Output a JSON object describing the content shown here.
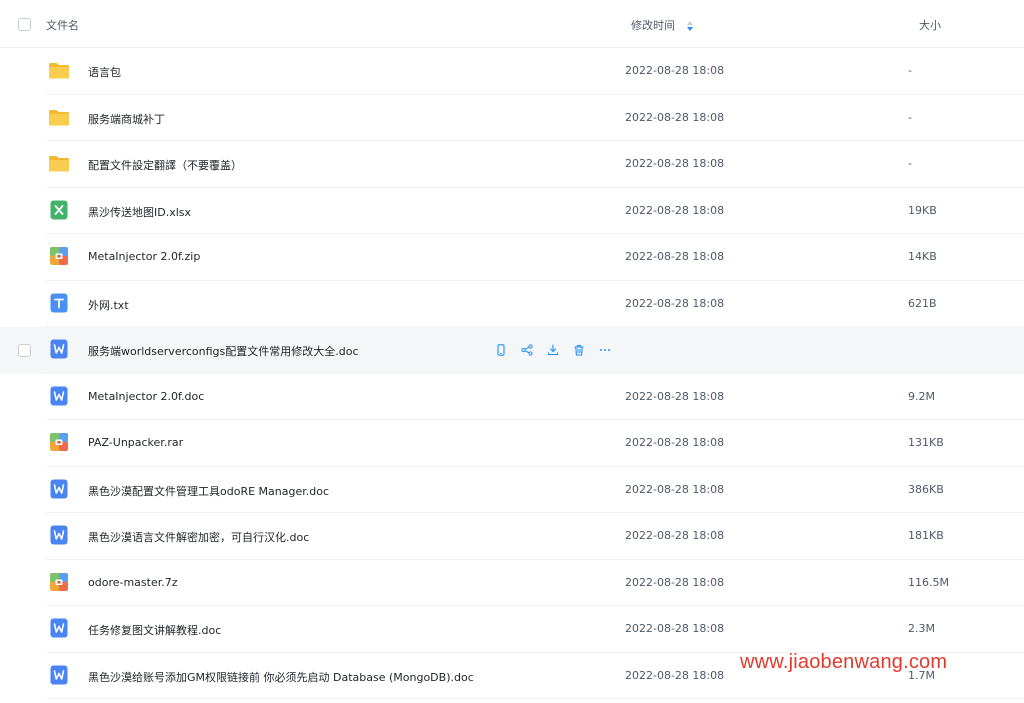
{
  "header": {
    "name_label": "文件名",
    "time_label": "修改时间",
    "size_label": "大小",
    "sort": "descending"
  },
  "files": [
    {
      "name": "语言包",
      "time": "2022-08-28 18:08",
      "size": "-",
      "type": "folder"
    },
    {
      "name": "服务端商城补丁",
      "time": "2022-08-28 18:08",
      "size": "-",
      "type": "folder"
    },
    {
      "name": "配置文件設定翻譯（不要覆盖）",
      "time": "2022-08-28 18:08",
      "size": "-",
      "type": "folder"
    },
    {
      "name": "黑沙传送地图ID.xlsx",
      "time": "2022-08-28 18:08",
      "size": "19KB",
      "type": "excel"
    },
    {
      "name": "MetaInjector 2.0f.zip",
      "time": "2022-08-28 18:08",
      "size": "14KB",
      "type": "archive"
    },
    {
      "name": "外网.txt",
      "time": "2022-08-28 18:08",
      "size": "621B",
      "type": "text"
    },
    {
      "name": "服务端worldserverconfigs配置文件常用修改大全.doc",
      "time": "",
      "size": "",
      "type": "word",
      "hovered": true
    },
    {
      "name": "MetaInjector 2.0f.doc",
      "time": "2022-08-28 18:08",
      "size": "9.2M",
      "type": "word"
    },
    {
      "name": "PAZ-Unpacker.rar",
      "time": "2022-08-28 18:08",
      "size": "131KB",
      "type": "archive"
    },
    {
      "name": "黑色沙漠配置文件管理工具odoRE Manager.doc",
      "time": "2022-08-28 18:08",
      "size": "386KB",
      "type": "word"
    },
    {
      "name": "黑色沙漠语言文件解密加密，可自行汉化.doc",
      "time": "2022-08-28 18:08",
      "size": "181KB",
      "type": "word"
    },
    {
      "name": "odore-master.7z",
      "time": "2022-08-28 18:08",
      "size": "116.5M",
      "type": "archive"
    },
    {
      "name": "任务修复图文讲解教程.doc",
      "time": "2022-08-28 18:08",
      "size": "2.3M",
      "type": "word"
    },
    {
      "name": "黑色沙漠给账号添加GM权限链接前 你必须先启动 Database (MongoDB).doc",
      "time": "2022-08-28 18:08",
      "size": "1.7M",
      "type": "word"
    }
  ],
  "row_actions": [
    "phone-icon",
    "share-icon",
    "download-icon",
    "delete-icon",
    "more-icon"
  ],
  "watermark": "www.jiaobenwang.com",
  "colors": {
    "accent": "#1e90ff",
    "folder": "#f7c33a",
    "word": "#4a84f4",
    "excel": "#43b36b",
    "text": "#4a8ff4",
    "watermark": "#e03a2f"
  }
}
